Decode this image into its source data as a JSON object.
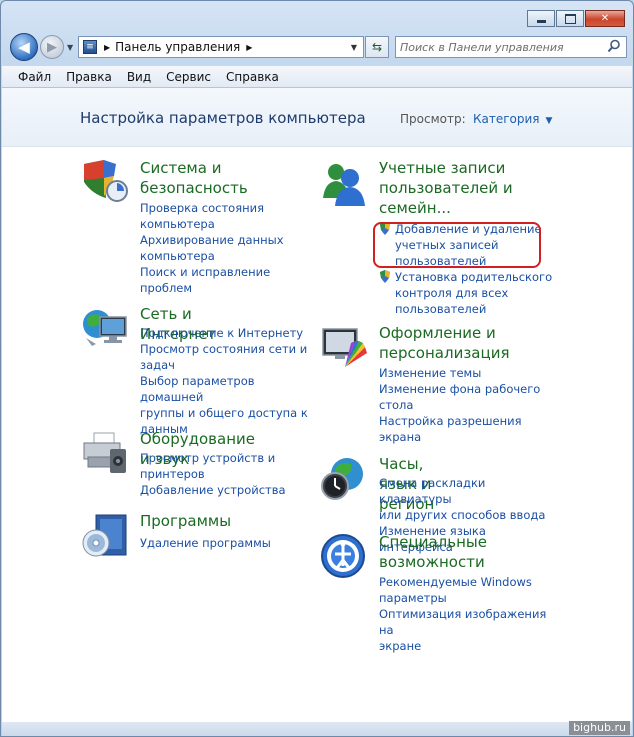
{
  "window": {
    "minimize": "",
    "maximize": "",
    "close": "✕"
  },
  "nav": {
    "back": "◀",
    "forward": "▶",
    "address": "Панель управления",
    "search_placeholder": "Поиск в Панели управления"
  },
  "menu": [
    "Файл",
    "Правка",
    "Вид",
    "Сервис",
    "Справка"
  ],
  "header": {
    "title": "Настройка параметров компьютера",
    "view_label": "Просмотр:",
    "view_value": "Категория"
  },
  "categories": {
    "system": {
      "title1": "Система и",
      "title2": "безопасность",
      "icon": "shield-icon",
      "links": [
        "Проверка состояния",
        "компьютера",
        "Архивирование данных",
        "компьютера",
        "Поиск и исправление",
        "проблем"
      ]
    },
    "network": {
      "title": "Сеть и Интернет",
      "icon": "network-globe-icon",
      "links": [
        "Подключение к Интернету",
        "Просмотр состояния сети и",
        "задач",
        "Выбор параметров домашней",
        "группы и общего доступа к",
        "данным"
      ]
    },
    "hardware": {
      "title": "Оборудование и звук",
      "icon": "printer-icon",
      "links": [
        "Просмотр устройств и",
        "принтеров",
        "Добавление устройства"
      ]
    },
    "programs": {
      "title": "Программы",
      "icon": "programs-disc-icon",
      "links": [
        "Удаление программы"
      ]
    },
    "users": {
      "title1": "Учетные записи",
      "title2": "пользователей и",
      "title3": "семейн...",
      "icon": "users-icon",
      "links": [
        "Добавление и удаление",
        "учетных записей",
        "пользователей",
        "Установка родительского",
        "контроля для всех",
        "пользователей"
      ]
    },
    "appearance": {
      "title1": "Оформление и",
      "title2": "персонализация",
      "icon": "monitor-palette-icon",
      "links": [
        "Изменение темы",
        "Изменение фона рабочего",
        "стола",
        "Настройка разрешения",
        "экрана"
      ]
    },
    "clock": {
      "title": "Часы, язык и регион",
      "icon": "clock-globe-icon",
      "links": [
        "Смена раскладки клавиатуры",
        "или других способов ввода",
        "Изменение языка интерфейса"
      ]
    },
    "access": {
      "title1": "Специальные",
      "title2": "возможности",
      "icon": "accessibility-icon",
      "links": [
        "Рекомендуемые Windows",
        "параметры",
        "Оптимизация изображения на",
        "экране"
      ]
    }
  },
  "watermark": "bighub.ru"
}
